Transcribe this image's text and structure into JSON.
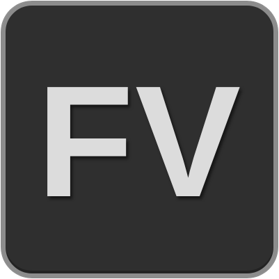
{
  "app_icon": {
    "label": "FV",
    "background_color": "#2f2f2f",
    "border_color": "#8c8c8c",
    "text_color": "#dcdcdc"
  }
}
